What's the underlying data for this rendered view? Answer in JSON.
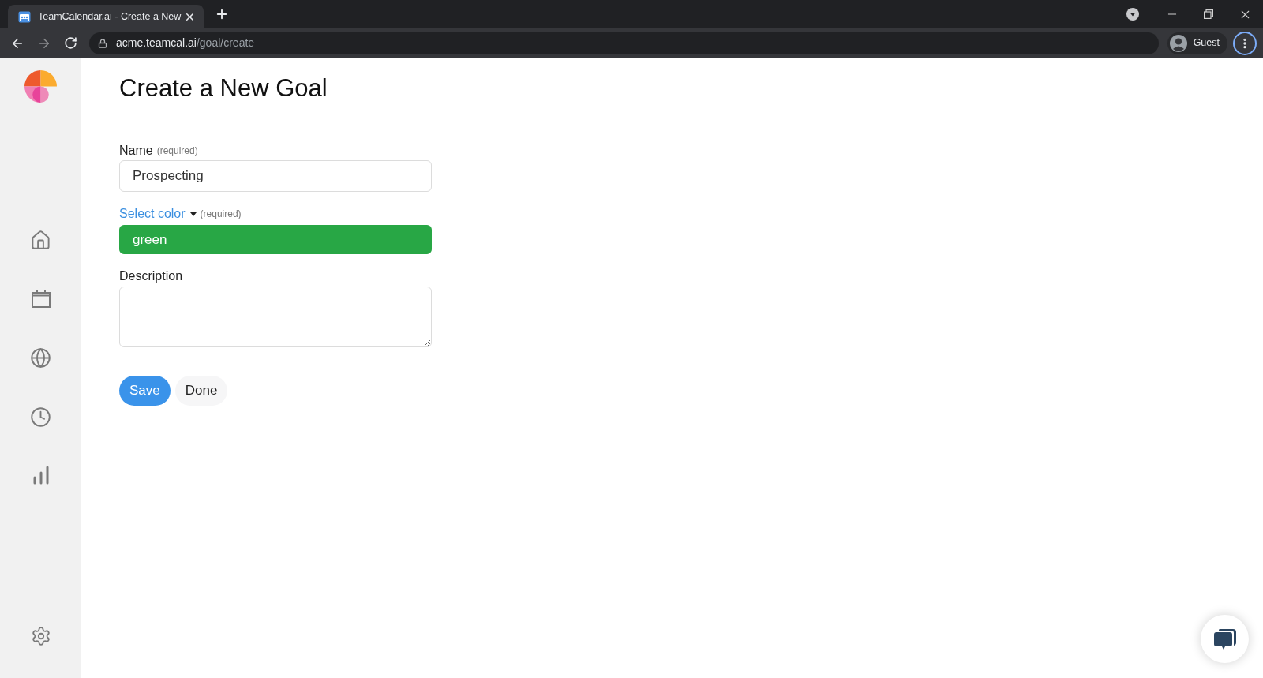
{
  "browser": {
    "tab": {
      "title": "TeamCalendar.ai - Create a New",
      "selected": true
    },
    "address": {
      "host": "acme.teamcal.ai",
      "path": "/goal/create"
    },
    "profile": {
      "label": "Guest"
    }
  },
  "page": {
    "title": "Create a New Goal"
  },
  "form": {
    "fields": [
      {
        "kind": "text",
        "label": "Name",
        "note": "(required)",
        "value": "Prospecting"
      },
      {
        "kind": "color",
        "label": "Select color",
        "note": "(required)",
        "value": "green",
        "color": "#28a745"
      },
      {
        "kind": "textarea",
        "label": "Description"
      }
    ]
  },
  "buttons": [
    {
      "kind": "primary",
      "label": "Save"
    },
    {
      "kind": "secondary",
      "label": "Done"
    }
  ]
}
